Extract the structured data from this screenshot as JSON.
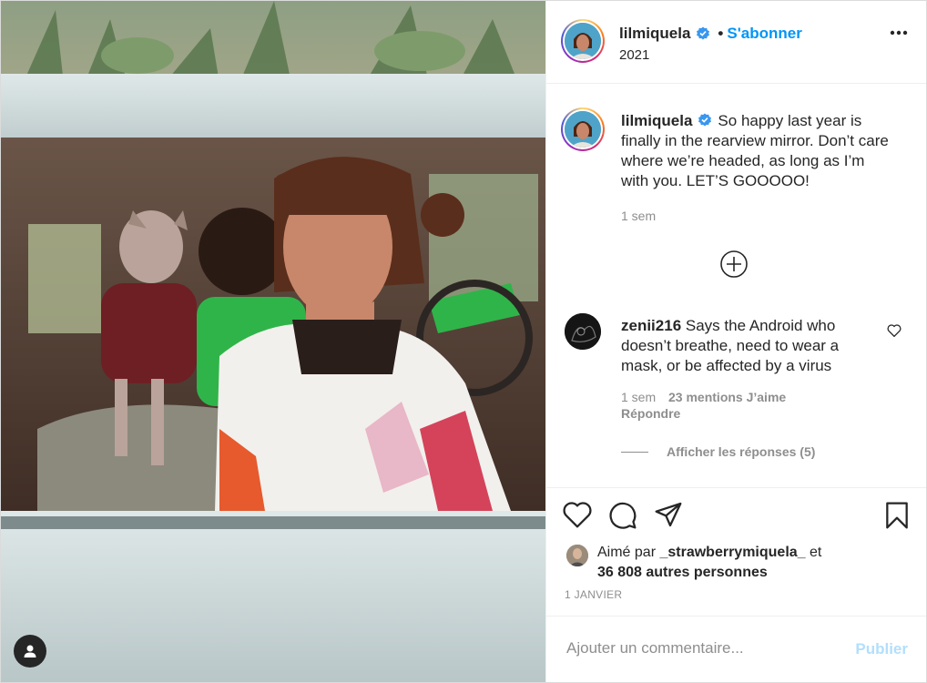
{
  "post": {
    "author": "lilmiquela",
    "follow_label": "S'abonner",
    "dot": "•",
    "year": "2021",
    "colors": {
      "accent": "#0095f6",
      "accent_disabled": "#b2dffc",
      "muted": "#8e8e8e",
      "text": "#262626"
    }
  },
  "caption": {
    "username": "lilmiquela",
    "text": "So happy last year is finally in the rearview mirror. Don’t care where we’re headed, as long as I’m with you. LET’S GOOOOO!",
    "age": "1 sem"
  },
  "comments": [
    {
      "username": "zenii216",
      "text": "Says the Android who doesn’t breathe, need to wear a mask, or be affected by a virus",
      "age": "1 sem",
      "likes": "23 mentions J’aime",
      "reply_label": "Répondre",
      "view_replies": "Afficher les réponses (5)"
    }
  ],
  "likes": {
    "prefix": "Aimé par",
    "liker": "_strawberrymiquela_",
    "conj": "et",
    "others": "36 808 autres personnes"
  },
  "date": "1 JANVIER",
  "add_comment": {
    "placeholder": "Ajouter un commentaire...",
    "publish_label": "Publier"
  }
}
